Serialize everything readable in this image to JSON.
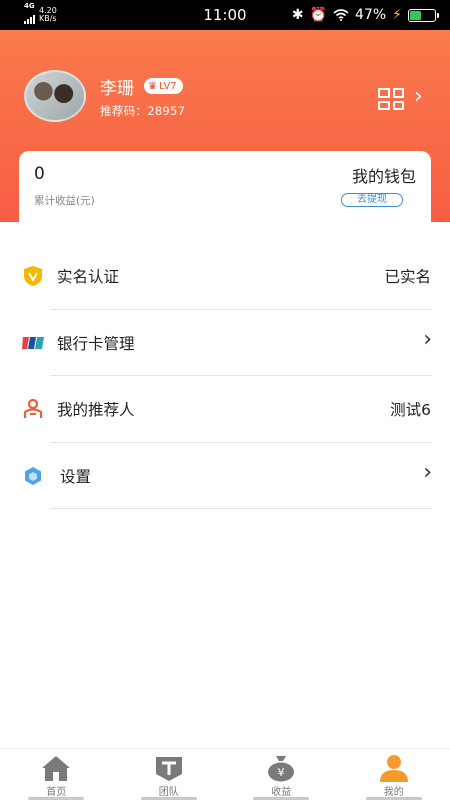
{
  "status_bar": {
    "network": "4G",
    "speed": "4.20",
    "speed_unit": "KB/s",
    "time": "11:00",
    "battery": "47%",
    "battery_level": 0.47
  },
  "profile": {
    "name": "李珊",
    "level": "LV7",
    "referral_code": "推荐码：28957"
  },
  "wallet": {
    "amount": "0",
    "caption": "累计收益(元)",
    "title": "我的钱包",
    "withdraw_label": "去提现"
  },
  "menu": {
    "items": [
      {
        "label": "实名认证",
        "value": "已实名",
        "icon": "verified-shield-icon"
      },
      {
        "label": "银行卡管理",
        "value": "",
        "icon": "bank-card-icon"
      },
      {
        "label": "我的推荐人",
        "value": "测试6",
        "icon": "referrer-icon"
      },
      {
        "label": "设置",
        "value": "",
        "icon": "settings-icon"
      }
    ]
  },
  "tabbar": {
    "tabs": [
      {
        "label": "首页",
        "icon": "home-icon"
      },
      {
        "label": "团队",
        "icon": "team-icon"
      },
      {
        "label": "收益",
        "icon": "money-bag-icon"
      },
      {
        "label": "我的",
        "icon": "profile-icon"
      }
    ],
    "active_index": 3
  },
  "colors": {
    "header_gradient_top": "#f97f4d",
    "header_gradient_bottom": "#f85d44",
    "accent_blue": "#3a8fd9",
    "tab_active": "#f79a2d",
    "tab_inactive": "#7a7a7a"
  }
}
